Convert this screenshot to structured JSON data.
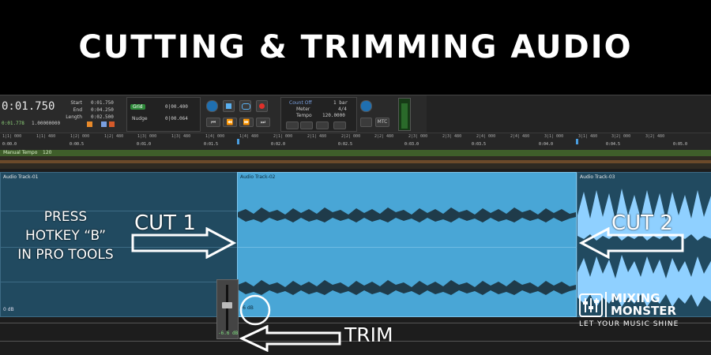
{
  "title": "CUTTING & TRIMMING AUDIO",
  "counter": {
    "main": "0:01.750",
    "sub": "0:01.778",
    "sub2": "1.00000000"
  },
  "selection": {
    "start_label": "Start",
    "end_label": "End",
    "length_label": "Length",
    "start": "0:01.750",
    "end": "0:04.250",
    "length": "0:02.500"
  },
  "grid": {
    "label": "Grid",
    "grid_value": "0|00.400",
    "nudge_label": "Nudge",
    "nudge_value": "0|00.064"
  },
  "tempo": {
    "count_off": "Count Off",
    "meter_label": "Meter",
    "tempo_label": "Tempo",
    "bars": "1 bar",
    "meter": "4/4",
    "tempo_value": "120.0000",
    "mtc": "MTC"
  },
  "ruler": {
    "bars": [
      "1|1| 000",
      "1|1| 480",
      "1|2| 000",
      "1|2| 480",
      "1|3| 000",
      "1|3| 480",
      "1|4| 000",
      "1|4| 480",
      "2|1| 000",
      "2|1| 480",
      "2|2| 000",
      "2|2| 480",
      "2|3| 000",
      "2|3| 480",
      "2|4| 000",
      "2|4| 480",
      "3|1| 000",
      "3|1| 480",
      "3|2| 000",
      "3|2| 480"
    ],
    "times": [
      "0:00.0",
      "0:00.5",
      "0:01.0",
      "0:01.5",
      "0:02.0",
      "0:02.5",
      "0:03.0",
      "0:03.5",
      "0:04.0",
      "0:04.5",
      "0:05.0"
    ]
  },
  "tempo_track": {
    "label": "Manual Tempo",
    "value": "120"
  },
  "clips": [
    {
      "name": "Audio Track-01",
      "gain": "0 dB"
    },
    {
      "name": "Audio Track-02",
      "gain": "-6 dB"
    },
    {
      "name": "Audio Track-03"
    }
  ],
  "fader_value": "-6.6 dB",
  "annotations": {
    "press": [
      "PRESS",
      "HOTKEY “B”",
      "IN PRO TOOLS"
    ],
    "cut1": "CUT 1",
    "cut2": "CUT 2",
    "trim": "TRIM"
  },
  "logo": {
    "line1": "MIXING",
    "line2": "MONSTER",
    "tagline": "LET YOUR MUSIC SHINE"
  },
  "colors": {
    "clip_selected": "#49a6d6",
    "clip_unselected": "#214a60",
    "waveform_dark": "#1f3b4a",
    "waveform_light": "#8fd0ff",
    "record": "#e0302a"
  }
}
